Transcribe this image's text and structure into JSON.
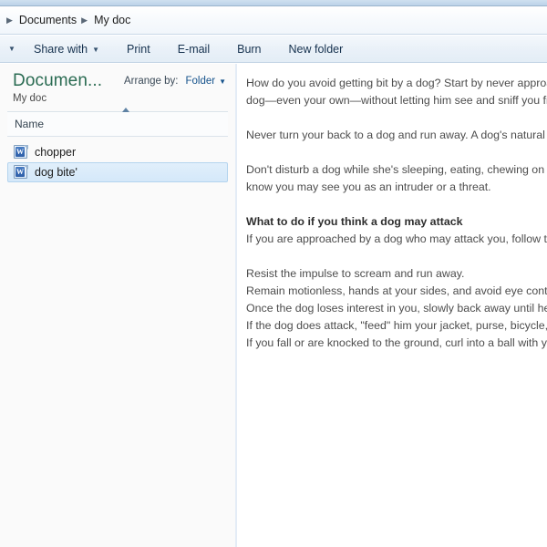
{
  "window": {
    "accent_color": "#2a6b52",
    "link_color": "#16538c"
  },
  "addressbar": {
    "separator_icon": "chevron-right-icon",
    "crumbs": [
      {
        "label": "Documents"
      },
      {
        "label": "My doc"
      }
    ]
  },
  "toolbar": {
    "overflow_caret_icon": "chevron-down-icon",
    "items": [
      {
        "label": "Share with",
        "has_caret": true,
        "caret_icon": "chevron-down-icon"
      },
      {
        "label": "Print",
        "has_caret": false
      },
      {
        "label": "E-mail",
        "has_caret": false
      },
      {
        "label": "Burn",
        "has_caret": false
      },
      {
        "label": "New folder",
        "has_caret": false
      }
    ]
  },
  "library": {
    "title": "Documen...",
    "subtitle": "My doc",
    "arrange_label": "Arrange by:",
    "arrange_value": "Folder",
    "arrange_caret_icon": "chevron-down-icon"
  },
  "file_list": {
    "column_header": "Name",
    "sort_indicator_icon": "sort-ascending-icon",
    "items": [
      {
        "name": "chopper",
        "icon": "word-document-icon",
        "selected": false
      },
      {
        "name": "dog bite'",
        "icon": "word-document-icon",
        "selected": true
      }
    ]
  },
  "document": {
    "paragraphs": [
      {
        "text": "How do you avoid getting bit by a dog? Start by never approaching a",
        "bold": false
      },
      {
        "text": "dog—even your own—without letting him see and sniff you first.",
        "bold": false
      },
      {
        "text": "",
        "bold": false
      },
      {
        "text": "Never turn your back to a dog and run away. A dog's natural instinct",
        "bold": false
      },
      {
        "text": "",
        "bold": false
      },
      {
        "text": "Don't disturb a dog while she's sleeping, eating, chewing on a toy, or",
        "bold": false
      },
      {
        "text": "know you may see you as an intruder or a threat.",
        "bold": false
      },
      {
        "text": "",
        "bold": false
      },
      {
        "text": "What to do if you think a dog may attack",
        "bold": true
      },
      {
        "text": "If you are approached by a dog who may attack you, follow these",
        "bold": false
      },
      {
        "text": "",
        "bold": false
      },
      {
        "text": "Resist the impulse to scream and run away.",
        "bold": false
      },
      {
        "text": "Remain motionless, hands at your sides, and avoid eye contact with",
        "bold": false
      },
      {
        "text": "Once the dog loses interest in you, slowly back away until he is out",
        "bold": false
      },
      {
        "text": "If the dog does attack, \"feed\" him your jacket, purse, bicycle, or any",
        "bold": false
      },
      {
        "text": "If you fall or are knocked to the ground, curl into a ball with your hea",
        "bold": false
      }
    ]
  }
}
